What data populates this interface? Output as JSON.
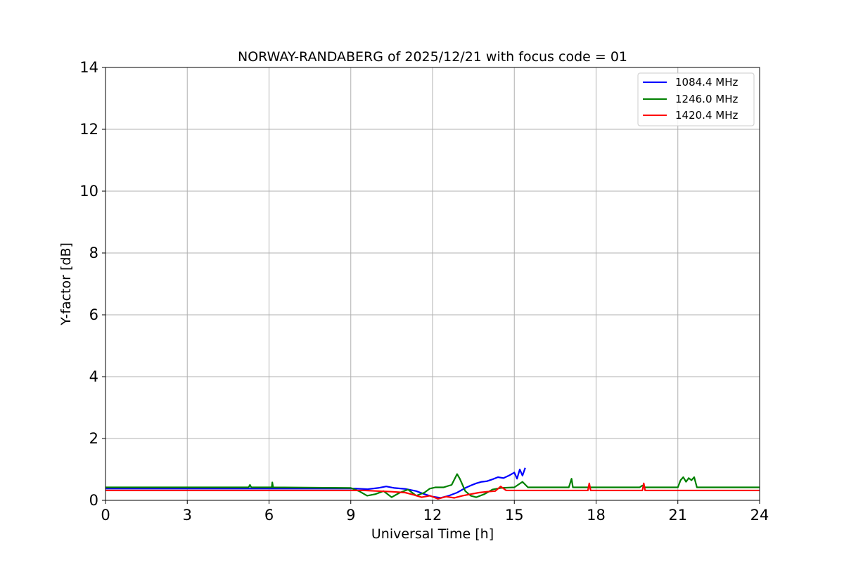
{
  "chart_data": {
    "type": "line",
    "title": "NORWAY-RANDABERG of 2025/12/21 with focus code = 01",
    "xlabel": "Universal Time [h]",
    "ylabel": "Y-factor [dB]",
    "xlim": [
      0,
      24
    ],
    "ylim": [
      0,
      14
    ],
    "xticks": [
      0,
      3,
      6,
      9,
      12,
      15,
      18,
      21,
      24
    ],
    "yticks": [
      0,
      2,
      4,
      6,
      8,
      10,
      12,
      14
    ],
    "grid": true,
    "legend_position": "top-right",
    "series": [
      {
        "name": "1084.4 MHz",
        "color": "#0000ff",
        "x": [
          0,
          9.2,
          9.6,
          10.0,
          10.3,
          10.6,
          11.0,
          11.4,
          11.7,
          12.0,
          12.3,
          12.6,
          12.9,
          13.2,
          13.4,
          13.6,
          13.8,
          14.0,
          14.2,
          14.4,
          14.6,
          14.8,
          15.0,
          15.1,
          15.2,
          15.3,
          15.4
        ],
        "y": [
          0.38,
          0.38,
          0.36,
          0.4,
          0.45,
          0.4,
          0.37,
          0.3,
          0.2,
          0.12,
          0.08,
          0.15,
          0.25,
          0.4,
          0.48,
          0.55,
          0.6,
          0.62,
          0.68,
          0.75,
          0.72,
          0.8,
          0.9,
          0.7,
          1.0,
          0.8,
          1.05
        ]
      },
      {
        "name": "1246.0 MHz",
        "color": "#008000",
        "x": [
          0,
          5.25,
          5.3,
          5.35,
          6.1,
          6.12,
          6.15,
          9.0,
          9.3,
          9.6,
          9.9,
          10.2,
          10.5,
          10.8,
          11.1,
          11.4,
          11.7,
          11.9,
          12.1,
          12.4,
          12.7,
          12.9,
          13.0,
          13.2,
          13.4,
          13.6,
          13.9,
          14.2,
          14.5,
          15.0,
          15.3,
          15.5,
          17.0,
          17.1,
          17.15,
          17.2,
          19.6,
          19.7,
          19.8,
          21.0,
          21.1,
          21.2,
          21.3,
          21.4,
          21.5,
          21.6,
          21.7,
          24
        ],
        "y": [
          0.42,
          0.42,
          0.5,
          0.42,
          0.42,
          0.58,
          0.42,
          0.4,
          0.3,
          0.15,
          0.2,
          0.3,
          0.1,
          0.25,
          0.35,
          0.15,
          0.25,
          0.38,
          0.42,
          0.42,
          0.5,
          0.85,
          0.7,
          0.3,
          0.15,
          0.1,
          0.2,
          0.35,
          0.4,
          0.42,
          0.6,
          0.42,
          0.42,
          0.7,
          0.42,
          0.42,
          0.42,
          0.48,
          0.42,
          0.42,
          0.65,
          0.75,
          0.6,
          0.72,
          0.65,
          0.75,
          0.42,
          0.42
        ]
      },
      {
        "name": "1420.4 MHz",
        "color": "#ff0000",
        "x": [
          0,
          9.5,
          10.0,
          10.5,
          11.0,
          11.3,
          11.6,
          11.9,
          12.2,
          12.5,
          12.8,
          13.1,
          13.4,
          13.7,
          14.0,
          14.3,
          14.5,
          14.7,
          15.0,
          17.0,
          17.7,
          17.75,
          17.8,
          19.7,
          19.75,
          19.8,
          24
        ],
        "y": [
          0.32,
          0.32,
          0.3,
          0.28,
          0.25,
          0.18,
          0.1,
          0.15,
          0.05,
          0.12,
          0.08,
          0.15,
          0.2,
          0.25,
          0.28,
          0.3,
          0.45,
          0.32,
          0.32,
          0.32,
          0.32,
          0.55,
          0.32,
          0.32,
          0.55,
          0.32,
          0.32
        ]
      }
    ]
  }
}
